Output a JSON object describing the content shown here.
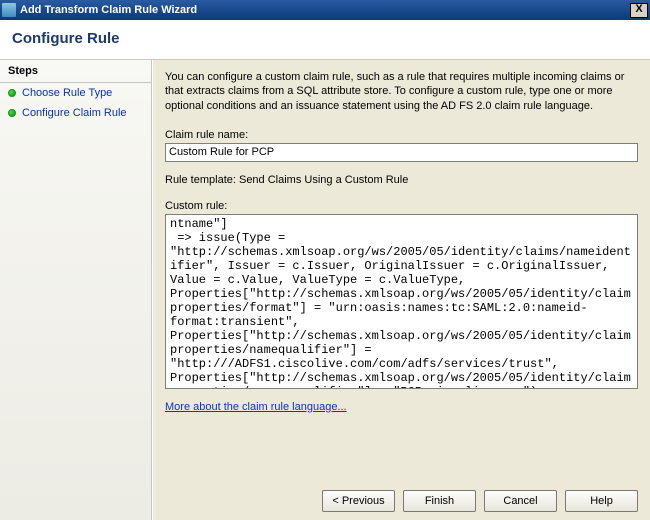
{
  "window": {
    "title": "Add Transform Claim Rule Wizard"
  },
  "header": "Configure Rule",
  "steps": {
    "heading": "Steps",
    "items": [
      {
        "label": "Choose Rule Type"
      },
      {
        "label": "Configure Claim Rule"
      }
    ]
  },
  "content": {
    "intro": "You can configure a custom claim rule, such as a rule that requires multiple incoming claims or that extracts claims from a SQL attribute store. To configure a custom rule, type one or more optional conditions and an issuance statement using the AD FS 2.0 claim rule language.",
    "claim_rule_name_label": "Claim rule name:",
    "claim_rule_name_value": "Custom Rule for PCP",
    "rule_template_line": "Rule template: Send Claims Using a Custom Rule",
    "custom_rule_label": "Custom rule:",
    "custom_rule_value": "ntname\"]\n => issue(Type = \"http://schemas.xmlsoap.org/ws/2005/05/identity/claims/nameidentifier\", Issuer = c.Issuer, OriginalIssuer = c.OriginalIssuer, Value = c.Value, ValueType = c.ValueType, Properties[\"http://schemas.xmlsoap.org/ws/2005/05/identity/claimproperties/format\"] = \"urn:oasis:names:tc:SAML:2.0:nameid-format:transient\", Properties[\"http://schemas.xmlsoap.org/ws/2005/05/identity/claimproperties/namequalifier\"] = \"http:///ADFS1.ciscolive.com/com/adfs/services/trust\", Properties[\"http://schemas.xmlsoap.org/ws/2005/05/identity/claimproperties/spnamequalifier\"] = \"PCP.ciscolive.com\");",
    "more_link": "More about the claim rule language..."
  },
  "buttons": {
    "previous": "< Previous",
    "finish": "Finish",
    "cancel": "Cancel",
    "help": "Help"
  }
}
